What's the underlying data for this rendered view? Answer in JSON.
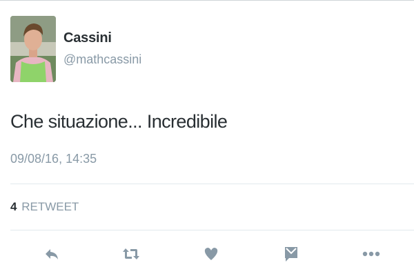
{
  "tweet": {
    "display_name": "Cassini",
    "handle": "@mathcassini",
    "text": "Che situazione... Incredibile",
    "timestamp": "09/08/16, 14:35",
    "retweets": {
      "count": "4",
      "label": "RETWEET"
    }
  },
  "actions": [
    {
      "icon": "reply-icon"
    },
    {
      "icon": "retweet-icon"
    },
    {
      "icon": "heart-icon"
    },
    {
      "icon": "direct-message-icon"
    },
    {
      "icon": "more-icon"
    }
  ],
  "colors": {
    "primary_text": "#292f33",
    "secondary_text": "#8899a6",
    "icon": "#8899a6",
    "divider": "#e1e8ed"
  }
}
